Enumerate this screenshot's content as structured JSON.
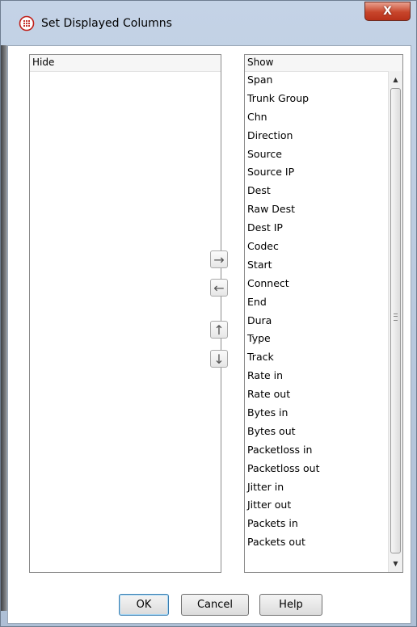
{
  "window": {
    "title": "Set Displayed Columns",
    "close_label": "X",
    "accent": "#c7452b"
  },
  "hide_list": {
    "header": "Hide",
    "items": []
  },
  "show_list": {
    "header": "Show",
    "items": [
      "Span",
      "Trunk Group",
      "Chn",
      "Direction",
      "Source",
      "Source IP",
      "Dest",
      "Raw Dest",
      "Dest IP",
      "Codec",
      "Start",
      "Connect",
      "End",
      "Dura",
      "Type",
      "Track",
      "Rate in",
      "Rate out",
      "Bytes in",
      "Bytes out",
      "Packetloss in",
      "Packetloss out",
      "Jitter in",
      "Jitter out",
      "Packets in",
      "Packets out"
    ]
  },
  "move_buttons": {
    "right_glyph": "→",
    "left_glyph": "←",
    "up_glyph": "↑",
    "down_glyph": "↓"
  },
  "scroll": {
    "up_glyph": "▲",
    "down_glyph": "▼"
  },
  "buttons": {
    "ok": "OK",
    "cancel": "Cancel",
    "help": "Help"
  }
}
